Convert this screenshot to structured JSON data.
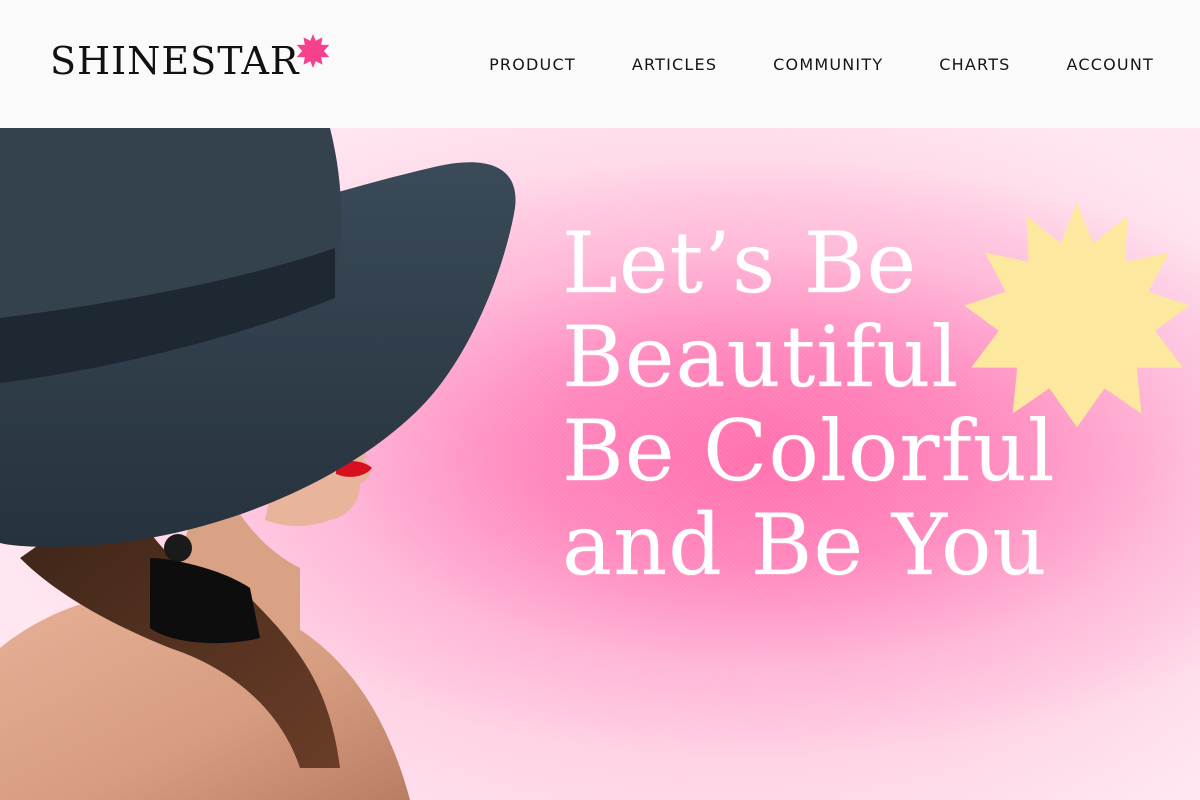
{
  "brand": {
    "name": "SHINESTAR",
    "star_color": "#f7418f"
  },
  "nav": {
    "items": [
      {
        "label": "PRODUCT"
      },
      {
        "label": "ARTICLES"
      },
      {
        "label": "COMMUNITY"
      },
      {
        "label": "CHARTS"
      },
      {
        "label": "ACCOUNT"
      }
    ]
  },
  "hero": {
    "headline_lines": [
      "Let’s Be",
      "Beautiful",
      "Be Colorful",
      "and Be You"
    ],
    "background_color": "#ff7fb6",
    "burst_color": "#fde8a0",
    "text_color": "#ffffff",
    "image": "woman-in-black-hat-photo"
  }
}
